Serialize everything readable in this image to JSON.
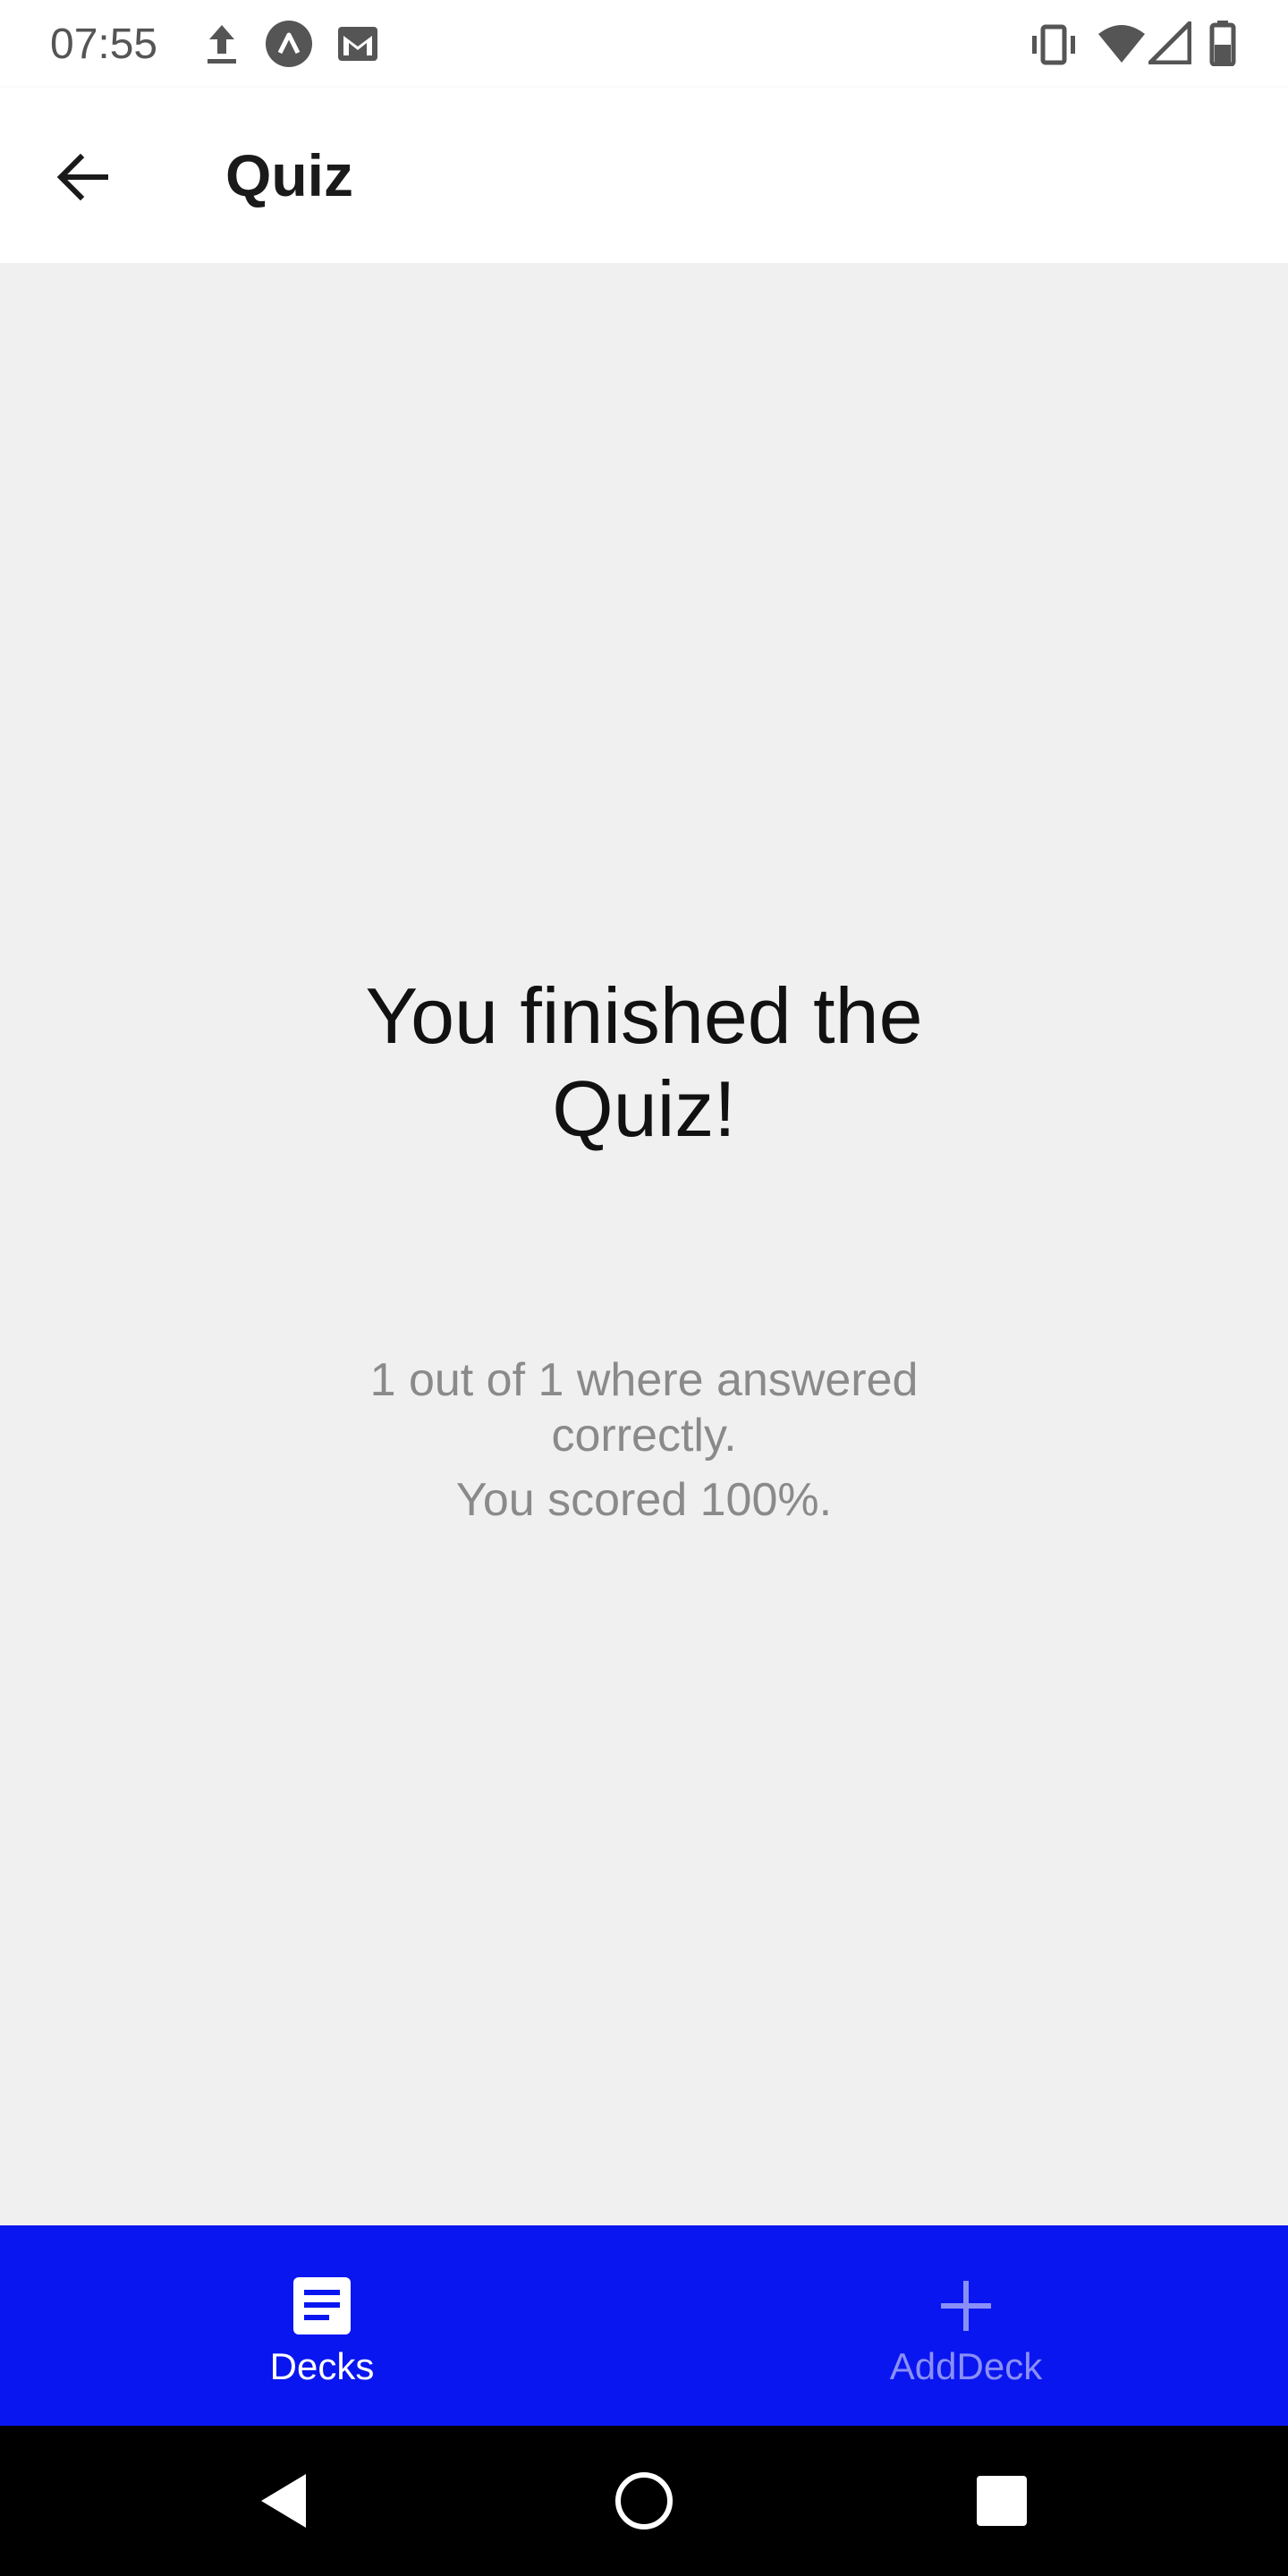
{
  "status_bar": {
    "time": "07:55",
    "left_icons": [
      "upload-icon",
      "app-notification-icon",
      "gmail-icon"
    ],
    "right_icons": [
      "vibrate-icon",
      "wifi-icon",
      "cell-signal-icon",
      "battery-icon"
    ]
  },
  "header": {
    "title": "Quiz",
    "back_icon": "arrow-left-icon"
  },
  "main": {
    "heading_line1": "You finished the",
    "heading_line2": "Quiz!",
    "result_line1": "1 out of 1 where answered",
    "result_line2": "correctly.",
    "score_line": "You scored 100%."
  },
  "tabs": [
    {
      "label": "Decks",
      "icon": "document-icon",
      "active": true
    },
    {
      "label": "AddDeck",
      "icon": "plus-icon",
      "active": false
    }
  ],
  "colors": {
    "tab_bar": "#0a16f0",
    "tab_active": "#ffffff",
    "tab_inactive": "#8a8ff7",
    "background": "#f0f0f0"
  }
}
